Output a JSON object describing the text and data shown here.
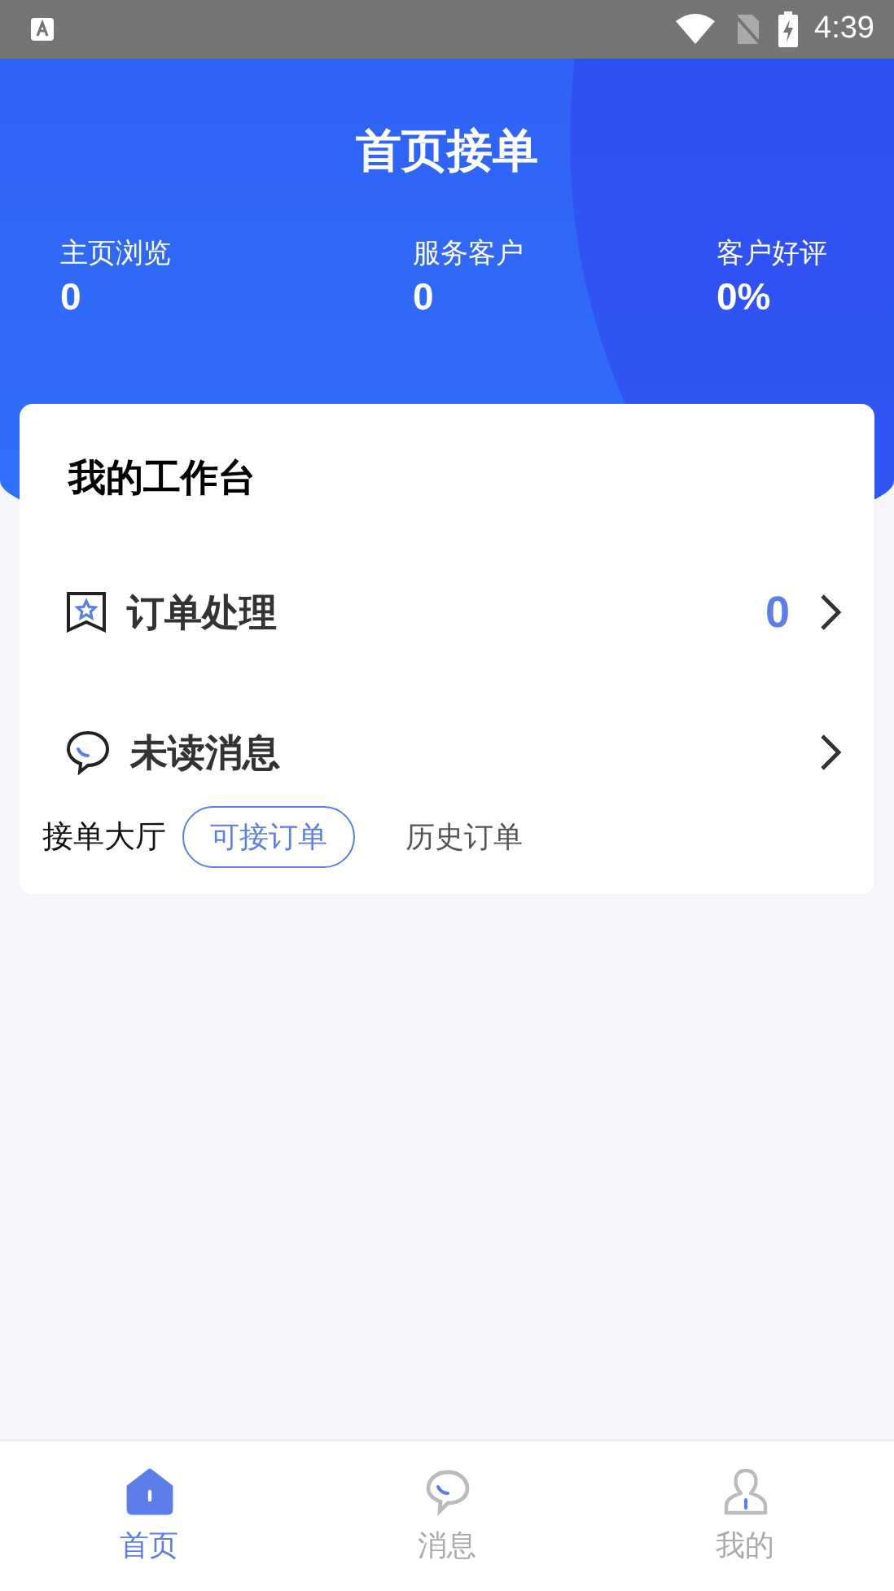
{
  "status_bar": {
    "time": "4:39"
  },
  "header": {
    "title": "首页接单",
    "stats": [
      {
        "label": "主页浏览",
        "value": "0"
      },
      {
        "label": "服务客户",
        "value": "0"
      },
      {
        "label": "客户好评",
        "value": "0%"
      }
    ]
  },
  "workbench": {
    "title": "我的工作台",
    "rows": [
      {
        "kind": "orders",
        "label": "订单处理",
        "count": "0"
      },
      {
        "kind": "messages",
        "label": "未读消息"
      }
    ]
  },
  "hall": {
    "label": "接单大厅",
    "tabs": [
      {
        "label": "可接订单",
        "selected": true
      },
      {
        "label": "历史订单",
        "selected": false
      }
    ]
  },
  "tab_bar": [
    {
      "kind": "home",
      "label": "首页",
      "selected": true
    },
    {
      "kind": "messages",
      "label": "消息",
      "selected": false
    },
    {
      "kind": "profile",
      "label": "我的",
      "selected": false
    }
  ]
}
